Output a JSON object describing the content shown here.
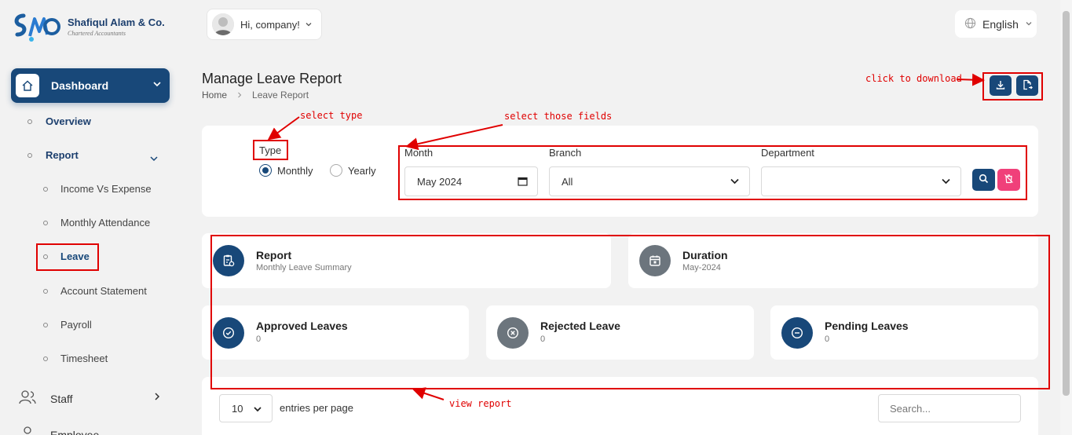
{
  "brand": {
    "name": "Shafiqul Alam & Co.",
    "tagline": "Chartered Accountants"
  },
  "topbar": {
    "greeting": "Hi, company!",
    "language": "English"
  },
  "sidebar": {
    "dashboard": "Dashboard",
    "overview": "Overview",
    "report": "Report",
    "report_items": [
      "Income Vs Expense",
      "Monthly Attendance",
      "Leave",
      "Account Statement",
      "Payroll",
      "Timesheet"
    ],
    "staff": "Staff",
    "employee": "Employee"
  },
  "page": {
    "title": "Manage Leave Report",
    "breadcrumb_home": "Home",
    "breadcrumb_current": "Leave Report"
  },
  "filters": {
    "type_label": "Type",
    "type_options": [
      "Monthly",
      "Yearly"
    ],
    "type_selected": "Monthly",
    "month_label": "Month",
    "month_value": "May 2024",
    "branch_label": "Branch",
    "branch_value": "All",
    "department_label": "Department",
    "department_value": ""
  },
  "summary": {
    "report_title": "Report",
    "report_sub": "Monthly Leave Summary",
    "duration_title": "Duration",
    "duration_sub": "May-2024",
    "approved_title": "Approved Leaves",
    "approved_value": "0",
    "rejected_title": "Rejected Leave",
    "rejected_value": "0",
    "pending_title": "Pending Leaves",
    "pending_value": "0"
  },
  "table": {
    "per_page_value": "10",
    "per_page_label": "entries per page",
    "search_placeholder": "Search..."
  },
  "annotations": {
    "download": "click to download",
    "select_type": "select type",
    "select_fields": "select those fields",
    "view_report": "view report"
  },
  "colors": {
    "primary": "#184879",
    "danger": "#f0407a",
    "annotation": "#e00000",
    "muted_icon": "#6c757d"
  }
}
